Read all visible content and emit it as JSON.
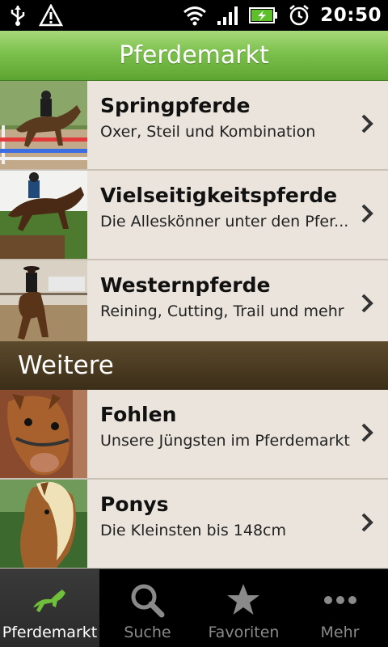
{
  "status_bar": {
    "time": "20:50",
    "icons": [
      "usb-icon",
      "warning-icon",
      "wifi-icon",
      "signal-icon",
      "battery-charging-icon",
      "alarm-icon"
    ]
  },
  "title_bar": {
    "title": "Pferdemarkt"
  },
  "list_items": [
    {
      "title": "Springpferde",
      "subtitle": "Oxer, Steil und Kombination"
    },
    {
      "title": "Vielseitigkeitspferde",
      "subtitle": "Die Alleskönner unter den Pfer..."
    },
    {
      "title": "Westernpferde",
      "subtitle": "Reining, Cutting, Trail und mehr"
    }
  ],
  "section_header": {
    "label": "Weitere"
  },
  "more_items": [
    {
      "title": "Fohlen",
      "subtitle": "Unsere Jüngsten im Pferdemarkt"
    },
    {
      "title": "Ponys",
      "subtitle": "Die Kleinsten bis 148cm"
    }
  ],
  "tabs": [
    {
      "label": "Pferdemarkt",
      "icon": "horse-icon",
      "active": true
    },
    {
      "label": "Suche",
      "icon": "search-icon",
      "active": false
    },
    {
      "label": "Favoriten",
      "icon": "star-icon",
      "active": false
    },
    {
      "label": "Mehr",
      "icon": "more-icon",
      "active": false
    }
  ],
  "colors": {
    "title_bar_green": "#7cc04d",
    "list_background": "#ebe4dc",
    "section_brown": "#4a3a20",
    "accent_green": "#6fbf3a"
  }
}
